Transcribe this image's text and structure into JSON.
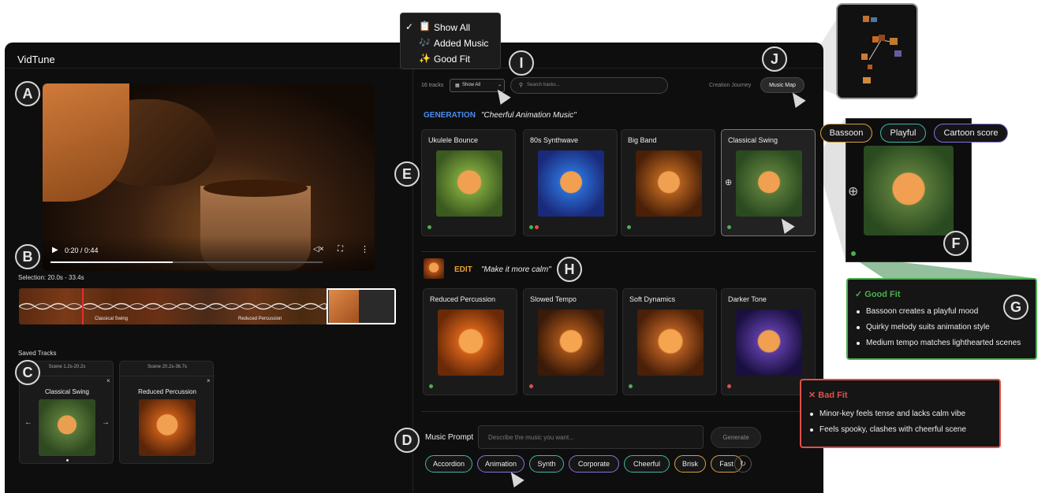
{
  "app": {
    "title": "VidTune"
  },
  "filter_menu": {
    "items": [
      {
        "icon": "clipboard",
        "label": "Show All",
        "checked": true
      },
      {
        "icon": "music",
        "label": "Added Music",
        "checked": false
      },
      {
        "icon": "sparkles",
        "label": "Good Fit",
        "checked": false
      }
    ]
  },
  "markers": {
    "a": "A",
    "b": "B",
    "c": "C",
    "d": "D",
    "e": "E",
    "f": "F",
    "g": "G",
    "h": "H",
    "i": "I",
    "j": "J"
  },
  "video": {
    "time": "0:20 / 0:44",
    "progress": 0.45
  },
  "selection": {
    "label": "Selection: 20.0s - 33.4s"
  },
  "timeline": {
    "labels": [
      "Classical Swing",
      "Reduced Percussion"
    ]
  },
  "saved": {
    "heading": "Saved Tracks",
    "tracks": [
      {
        "scene": "Scene 1.2s-20.2s",
        "title": "Classical Swing",
        "close": "×"
      },
      {
        "scene": "Scene 20.2s-36.7s",
        "title": "Reduced Percussion",
        "close": "×"
      }
    ],
    "arrow_left": "←",
    "arrow_right": "→"
  },
  "toolbar": {
    "count": "16 tracks",
    "filter": "Show All",
    "search_placeholder": "Search tracks...",
    "journey": "Creation Journey",
    "map": "Music Map"
  },
  "generation": {
    "label": "GENERATION",
    "prompt": "\"Cheerful Animation Music\"",
    "cards": [
      {
        "title": "Ukulele Bounce",
        "dots": [
          "#4caf50"
        ]
      },
      {
        "title": "80s Synthwave",
        "dots": [
          "#4caf50",
          "#e0504a"
        ]
      },
      {
        "title": "Big Band",
        "dots": [
          "#4caf50"
        ]
      },
      {
        "title": "Classical Swing",
        "dots": [
          "#4caf50"
        ]
      }
    ]
  },
  "edit": {
    "label": "EDIT",
    "prompt": "\"Make it more calm\"",
    "cards": [
      {
        "title": "Reduced Percussion",
        "dots": [
          "#4caf50"
        ]
      },
      {
        "title": "Slowed Tempo",
        "dots": [
          "#e0504a"
        ]
      },
      {
        "title": "Soft Dynamics",
        "dots": [
          "#4caf50"
        ]
      },
      {
        "title": "Darker Tone",
        "dots": [
          "#e0504a"
        ]
      }
    ]
  },
  "prompt": {
    "label": "Music Prompt",
    "placeholder": "Describe the music you want...",
    "generate": "Generate",
    "chips": [
      {
        "label": "Accordion",
        "color": "#3fb8a6"
      },
      {
        "label": "Animation",
        "color": "#8a6fe0"
      },
      {
        "label": "Synth",
        "color": "#3fb8a6"
      },
      {
        "label": "Corporate",
        "color": "#8a6fe0"
      },
      {
        "label": "Cheerful",
        "color": "#3fb8a6"
      },
      {
        "label": "Brisk",
        "color": "#d9a03c"
      },
      {
        "label": "Fast",
        "color": "#d9a03c"
      }
    ]
  },
  "detail": {
    "tags": [
      {
        "label": "Bassoon",
        "color": "#d9a03c"
      },
      {
        "label": "Playful",
        "color": "#3fb8a6"
      },
      {
        "label": "Cartoon score",
        "color": "#8a6fe0"
      }
    ]
  },
  "good_fit": {
    "title": "✓ Good Fit",
    "reasons": [
      "Bassoon creates a playful mood",
      "Quirky melody suits animation style",
      "Medium tempo matches lighthearted scenes"
    ]
  },
  "bad_fit": {
    "title": "✕ Bad Fit",
    "reasons": [
      "Minor-key feels tense and lacks calm vibe",
      "Feels spooky, clashes with cheerful scene"
    ]
  }
}
